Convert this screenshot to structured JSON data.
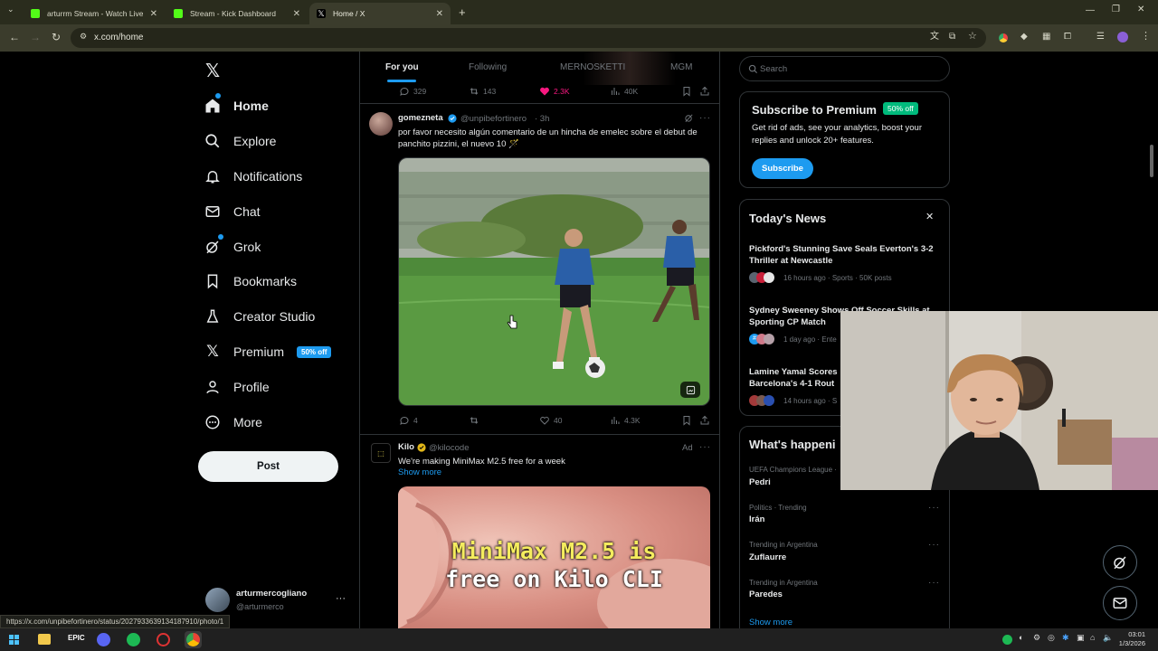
{
  "browser": {
    "tabs": [
      {
        "title": "arturrm Stream - Watch Live on Kick",
        "favicon_color": "#53fc18",
        "active": false
      },
      {
        "title": "Stream - Kick Dashboard",
        "favicon_color": "#53fc18",
        "active": false
      },
      {
        "title": "Home / X",
        "favicon_color": "#ffffff",
        "active": true
      }
    ],
    "new_tab": "+",
    "url": "x.com/home",
    "status_url": "https://x.com/unpibefortinero/status/2027933639134187910/photo/1"
  },
  "nav": {
    "items": [
      {
        "id": "home",
        "label": "Home"
      },
      {
        "id": "explore",
        "label": "Explore"
      },
      {
        "id": "notifications",
        "label": "Notifications"
      },
      {
        "id": "chat",
        "label": "Chat"
      },
      {
        "id": "grok",
        "label": "Grok"
      },
      {
        "id": "bookmarks",
        "label": "Bookmarks"
      },
      {
        "id": "creator-studio",
        "label": "Creator Studio"
      },
      {
        "id": "premium",
        "label": "Premium"
      },
      {
        "id": "profile",
        "label": "Profile"
      },
      {
        "id": "more",
        "label": "More"
      }
    ],
    "premium_badge": "50% off",
    "post_label": "Post",
    "account": {
      "name": "arturmercogliano",
      "handle": "@arturmerco",
      "more": "···"
    }
  },
  "feed": {
    "tabs": [
      "For you",
      "Following",
      "MERNOSKETTI",
      "MGM"
    ],
    "prev_actions": {
      "replies": "329",
      "reposts": "143",
      "likes": "2.3K",
      "views": "40K"
    },
    "tweet": {
      "name": "gomezneta",
      "handle": "@unpibefortinero",
      "time": "· 3h",
      "text": "por favor necesito algún comentario de un hincha de emelec sobre el debut de panchito pizzini, el nuevo 10 🪄",
      "actions": {
        "replies": "4",
        "reposts": "",
        "likes": "40",
        "views": "4.3K"
      }
    },
    "ad": {
      "name": "Kilo",
      "handle": "@kilocode",
      "ad_label": "Ad",
      "text": "We're making MiniMax M2.5 free for a week",
      "show_more": "Show more",
      "image_line1": "MiniMax M2.5 is",
      "image_line2": "free on Kilo CLI"
    }
  },
  "right": {
    "search_placeholder": "Search",
    "premium": {
      "title": "Subscribe to Premium",
      "badge": "50% off",
      "body": "Get rid of ads, see your analytics, boost your replies and unlock 20+ features.",
      "button": "Subscribe"
    },
    "news": {
      "title": "Today's News",
      "close": "✕",
      "items": [
        {
          "headline": "Pickford's Stunning Save Seals Everton's 3-2 Thriller at Newcastle",
          "meta": "16 hours ago · Sports · 50K posts"
        },
        {
          "headline": "Sydney Sweeney Shows Off Soccer Skills at Sporting CP Match",
          "meta": "1 day ago · Ente"
        },
        {
          "headline": "Lamine Yamal Scores",
          "headline2": "Barcelona's 4-1 Rout",
          "meta": "14 hours ago · S"
        }
      ]
    },
    "happening": {
      "title": "What's happeni",
      "trends": [
        {
          "context": "UEFA Champions League ·",
          "name": "Pedri"
        },
        {
          "context": "Politics · Trending",
          "name": "Irán"
        },
        {
          "context": "Trending in Argentina",
          "name": "Zuflaurre"
        },
        {
          "context": "Trending in Argentina",
          "name": "Paredes"
        }
      ],
      "show_more": "Show more"
    }
  },
  "taskbar": {
    "time": "03:01",
    "date": "1/3/2026"
  },
  "colors": {
    "accent": "#1d9bf0",
    "like": "#f91880",
    "premium_green": "#00ba7c"
  }
}
